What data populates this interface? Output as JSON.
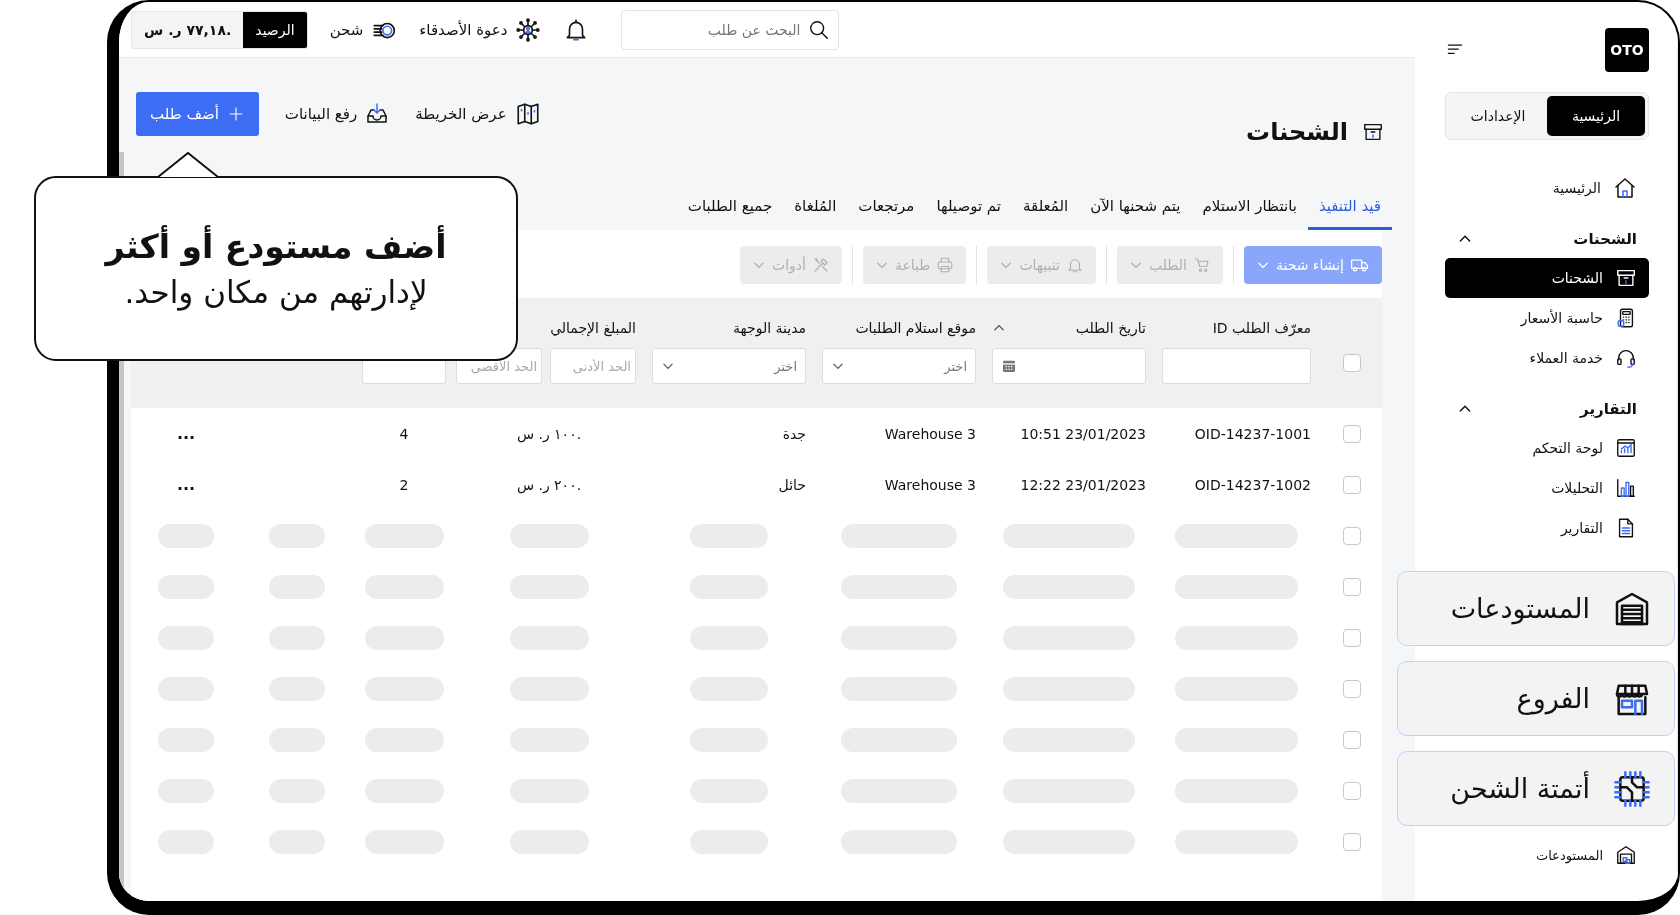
{
  "topbar": {
    "search": {
      "placeholder": "البحث عن طلب"
    },
    "invite": "دعوة الأصدقاء",
    "recharge": "شحن",
    "balance": {
      "label": "الرصيد",
      "value": "٧٧,١٨ ر. س."
    }
  },
  "header": {
    "title": "الشحنات",
    "buttons": [
      {
        "kind": "link",
        "label": "عرض الخريطة"
      },
      {
        "kind": "link",
        "label": "رفع البيانات"
      },
      {
        "kind": "primary",
        "label": "أضف طلب"
      }
    ]
  },
  "tabs": [
    {
      "label": "قيد التنفيذ",
      "selected": true
    },
    {
      "label": "بانتظار الاستلام",
      "selected": false
    },
    {
      "label": "يتم شحنها الآن",
      "selected": false
    },
    {
      "label": "المُعلقة",
      "selected": false
    },
    {
      "label": "تم توصيلها",
      "selected": false
    },
    {
      "label": "مرتجعات",
      "selected": false
    },
    {
      "label": "المُلغاة",
      "selected": false
    },
    {
      "label": "جميع الطلبات",
      "selected": false
    }
  ],
  "toolbar": [
    {
      "label": "إنشاء شحنة",
      "disabled": false
    },
    {
      "label": "الطلب",
      "disabled": true
    },
    {
      "label": "تنبيهات",
      "disabled": true
    },
    {
      "label": "طباعة",
      "disabled": true
    },
    {
      "label": "أدوات",
      "disabled": true
    }
  ],
  "table": {
    "header_checkbox": {
      "checked": false
    },
    "columns": [
      {
        "label": "معرّف الطلب ID",
        "filter": {
          "kind": "text"
        }
      },
      {
        "label": "تاريخ الطلب",
        "filter": {
          "kind": "date"
        }
      },
      {
        "label": "موقع استلام الطلبات",
        "filter": {
          "kind": "select",
          "placeholder": "اختر"
        }
      },
      {
        "label": "مدينة الوجهة",
        "filter": {
          "kind": "select",
          "placeholder": "اختر"
        }
      },
      {
        "label": "المبلغ الإجمالي",
        "filter": {
          "kind": "range",
          "min_placeholder": "الحد الأدنى",
          "max_placeholder": "الحد الاقصى"
        }
      },
      {
        "filter": {
          "kind": "text"
        }
      }
    ],
    "rows": [
      {
        "kind": "data",
        "checked": false,
        "cells": [
          "OID-14237-1001",
          "10:51 23/01/2023",
          "Warehouse 3",
          "جدة",
          "١٠٠ ر. س.",
          "4"
        ],
        "actions": "..."
      },
      {
        "kind": "data",
        "checked": false,
        "cells": [
          "OID-14237-1002",
          "12:22 23/01/2023",
          "Warehouse 3",
          "حائل",
          "٢٠٠ ر. س.",
          "2"
        ],
        "actions": "..."
      },
      {
        "kind": "skeleton",
        "checked": false
      },
      {
        "kind": "skeleton",
        "checked": false
      },
      {
        "kind": "skeleton",
        "checked": false
      },
      {
        "kind": "skeleton",
        "checked": false
      },
      {
        "kind": "skeleton",
        "checked": false
      },
      {
        "kind": "skeleton",
        "checked": false
      },
      {
        "kind": "skeleton",
        "checked": false
      }
    ]
  },
  "sidebar": {
    "logo": "OTO",
    "tabs": [
      {
        "label": "الرئيسية",
        "selected": true
      },
      {
        "label": "الإعدادات",
        "selected": false
      }
    ],
    "items": [
      {
        "kind": "link",
        "label": "الرئيسية",
        "selected": false
      },
      {
        "kind": "section",
        "label": "الشحنات",
        "expanded": true,
        "children": [
          {
            "label": "الشحنات",
            "selected": true
          },
          {
            "label": "حاسبة الأسعار",
            "selected": false
          },
          {
            "label": "خدمة العملاء",
            "selected": false
          }
        ]
      },
      {
        "kind": "section",
        "label": "التقارير",
        "expanded": true,
        "children": [
          {
            "label": "لوحة التحكم",
            "selected": false
          },
          {
            "label": "التحليلات",
            "selected": false
          },
          {
            "label": "التقارير",
            "selected": false
          }
        ]
      }
    ],
    "bottom_item": {
      "label": "المستودعات",
      "selected": false
    }
  },
  "feature_cards": [
    {
      "label": "المستودعات"
    },
    {
      "label": "الفروع"
    },
    {
      "label": "أتمتة الشحن"
    }
  ],
  "tooltip": {
    "title": "أضف مستودع أو أكثر",
    "text": "لإدارتهم من مكان واحد."
  }
}
